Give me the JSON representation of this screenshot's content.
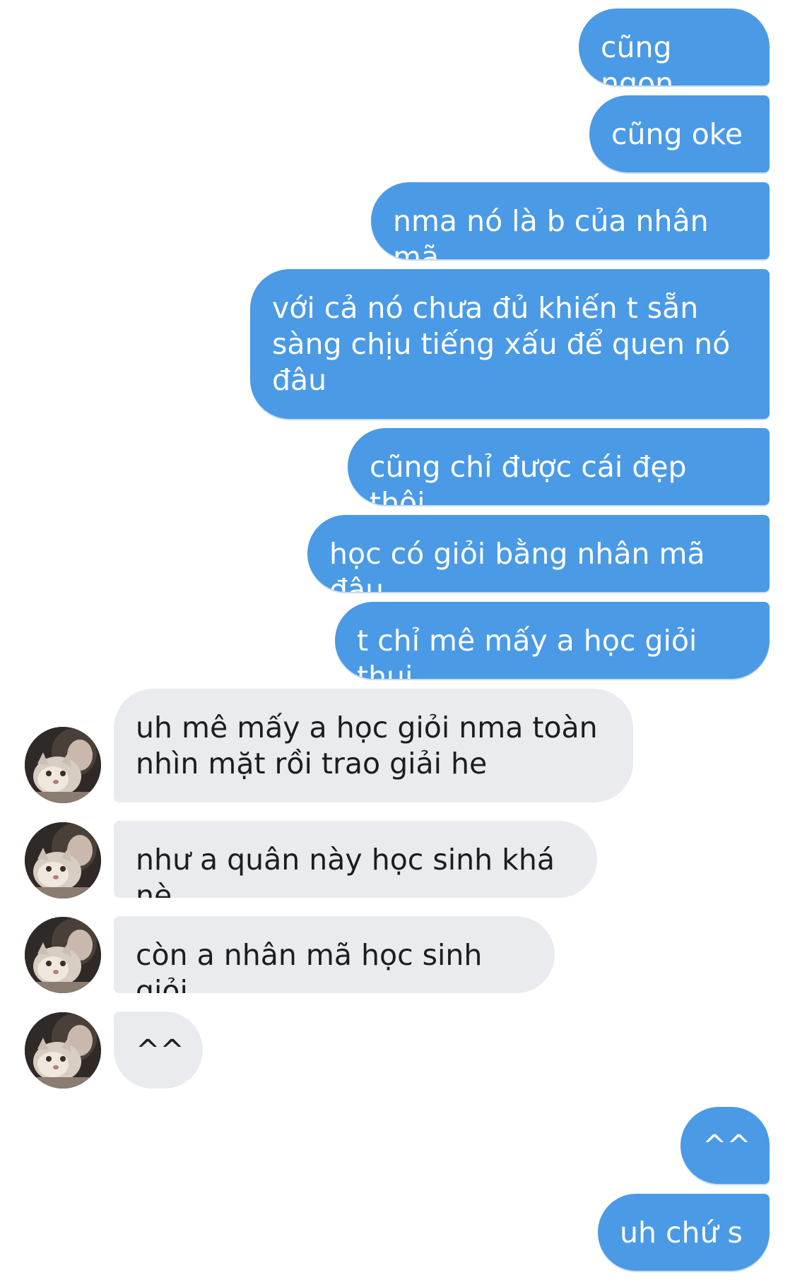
{
  "conversation": {
    "messages": [
      {
        "sender": "me",
        "text": "cũng ngon"
      },
      {
        "sender": "me",
        "text": "cũng oke"
      },
      {
        "sender": "me",
        "text": "nma nó là b của nhân mã"
      },
      {
        "sender": "me",
        "text": "với cả nó chưa đủ khiến t sẵn sàng chịu tiếng xấu để quen nó đâu"
      },
      {
        "sender": "me",
        "text": "cũng chỉ được cái đẹp thôi"
      },
      {
        "sender": "me",
        "text": "học có giỏi bằng nhân mã đâu"
      },
      {
        "sender": "me",
        "text": "t chỉ mê mấy a học giỏi thui"
      },
      {
        "sender": "them",
        "text": "uh mê mấy a học giỏi nma toàn nhìn mặt rồi trao giải he"
      },
      {
        "sender": "them",
        "text": "như a quân này học sinh khá nè"
      },
      {
        "sender": "them",
        "text": "còn a nhân mã học sinh giỏi"
      },
      {
        "sender": "them",
        "text": "^^"
      },
      {
        "sender": "me",
        "text": "^^"
      },
      {
        "sender": "me",
        "text": "uh chứ s"
      }
    ]
  },
  "colors": {
    "outgoing_bubble": "#4a9ae6",
    "incoming_bubble": "#e9ebee",
    "outgoing_text": "#ffffff",
    "incoming_text": "#1d1d1f"
  },
  "icons": {
    "avatar": "contact-avatar-photo"
  }
}
